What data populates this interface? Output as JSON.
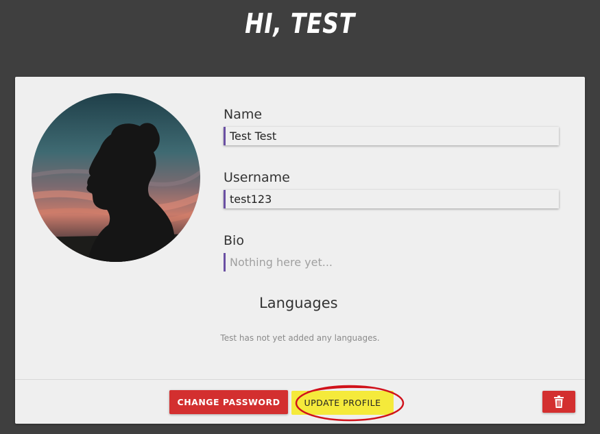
{
  "header": {
    "title": "HI, TEST"
  },
  "profile": {
    "avatar_icon": "woman-silhouette-sunset",
    "name": {
      "label": "Name",
      "value": "Test Test"
    },
    "username": {
      "label": "Username",
      "value": "test123"
    },
    "bio": {
      "label": "Bio",
      "value": "",
      "placeholder": "Nothing here yet..."
    }
  },
  "languages": {
    "heading": "Languages",
    "empty_message": "Test has not yet added any languages."
  },
  "actions": {
    "change_password_label": "CHANGE PASSWORD",
    "update_profile_label": "UPDATE PROFILE",
    "delete_icon": "trash-icon"
  },
  "colors": {
    "background": "#3f3f3f",
    "card": "#efefef",
    "accent_border": "#6a4fa3",
    "danger": "#d32f2f",
    "highlight": "#f5ea3b",
    "annotation": "#d0121b"
  }
}
